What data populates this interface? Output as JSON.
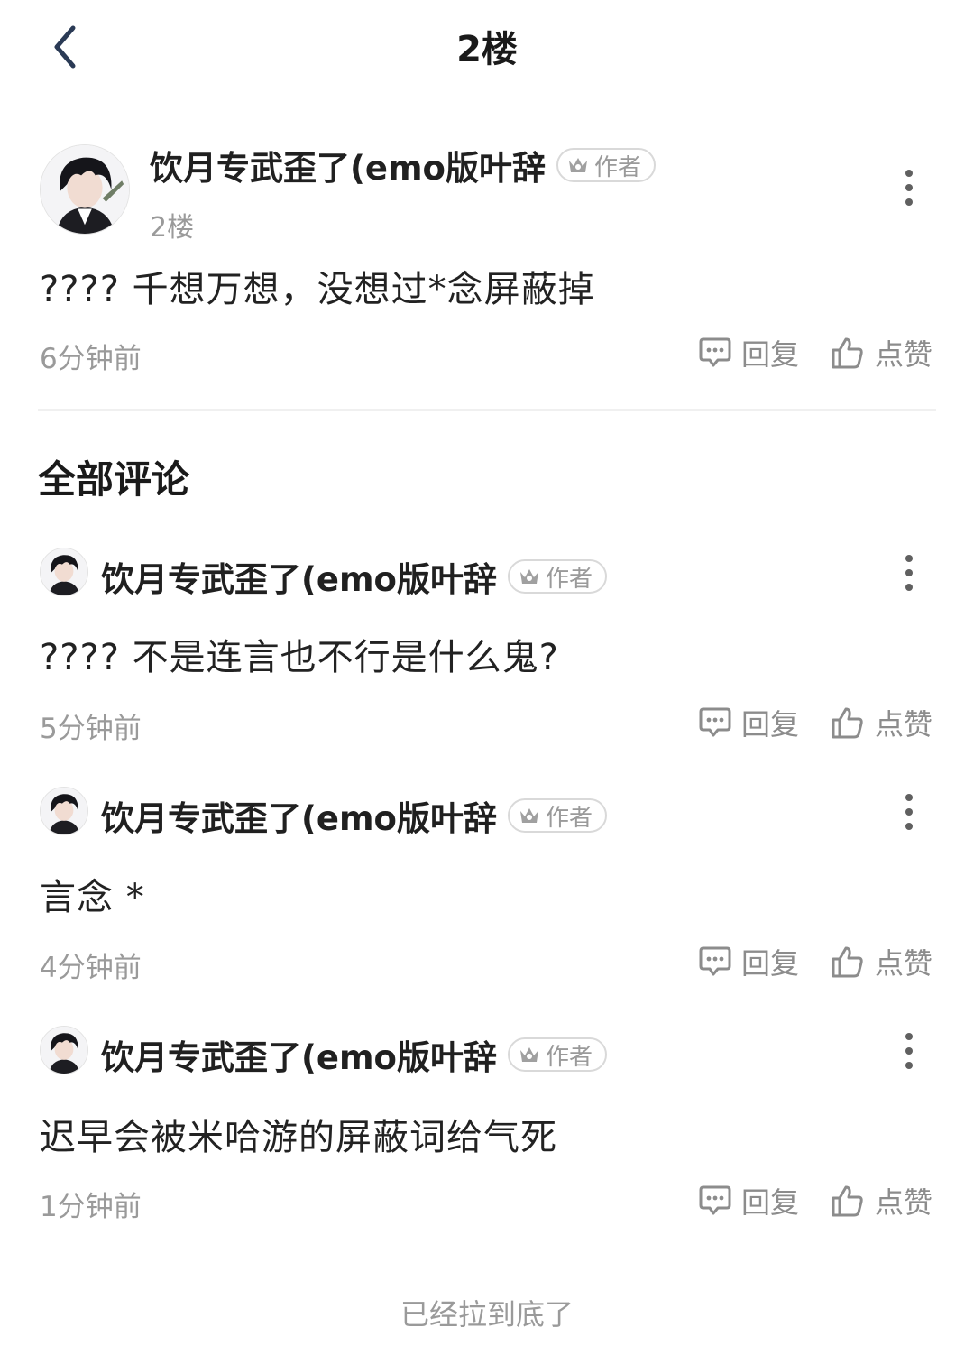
{
  "header": {
    "title": "2楼"
  },
  "post": {
    "author": "饮月专武歪了(emo版叶辞",
    "badge": "作者",
    "floor": "2楼",
    "content": "????  千想万想，没想过*念屏蔽掉",
    "time": "6分钟前",
    "reply_label": "回复",
    "like_label": "点赞"
  },
  "comments_section": {
    "title": "全部评论"
  },
  "comments": [
    {
      "author": "饮月专武歪了(emo版叶辞",
      "badge": "作者",
      "content": "????  不是连言也不行是什么鬼?",
      "time": "5分钟前",
      "reply_label": "回复",
      "like_label": "点赞"
    },
    {
      "author": "饮月专武歪了(emo版叶辞",
      "badge": "作者",
      "content": "言念 *",
      "time": "4分钟前",
      "reply_label": "回复",
      "like_label": "点赞"
    },
    {
      "author": "饮月专武歪了(emo版叶辞",
      "badge": "作者",
      "content": "迟早会被米哈游的屏蔽词给气死",
      "time": "1分钟前",
      "reply_label": "回复",
      "like_label": "点赞"
    }
  ],
  "footer": {
    "text": "已经拉到底了"
  },
  "icons": {
    "back": "chevron-left-icon",
    "badge": "crown-icon",
    "reply": "comment-bubble-icon",
    "like": "thumbs-up-icon",
    "more": "more-vertical-icon"
  }
}
